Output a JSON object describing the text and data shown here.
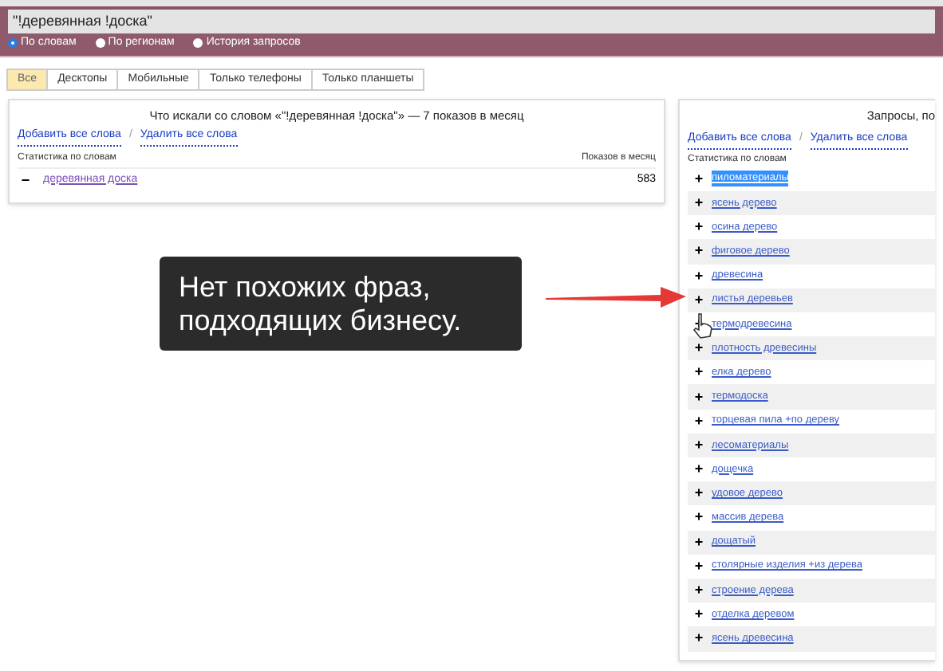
{
  "search": {
    "value": "\"!деревянная !доска\""
  },
  "modes": [
    {
      "label": "По словам",
      "selected": true
    },
    {
      "label": "По регионам",
      "selected": false
    },
    {
      "label": "История запросов",
      "selected": false
    }
  ],
  "tabs": [
    {
      "label": "Все",
      "selected": true
    },
    {
      "label": "Десктопы",
      "selected": false
    },
    {
      "label": "Мобильные",
      "selected": false
    },
    {
      "label": "Только телефоны",
      "selected": false
    },
    {
      "label": "Только планшеты",
      "selected": false
    }
  ],
  "left_panel": {
    "title": "Что искали со словом «\"!деревянная !доска\"» — 7 показов в месяц",
    "add_all": "Добавить все слова",
    "separator": "/",
    "remove_all": "Удалить все слова",
    "columns": [
      "Статистика по словам",
      "Показов в месяц"
    ],
    "rows": [
      {
        "action": "−",
        "phrase": "деревянная доска",
        "count": "583"
      }
    ]
  },
  "callout": {
    "lines": [
      "Нет похожих фраз,",
      "подходящих бизнесу."
    ]
  },
  "right_panel": {
    "title": "Запросы, по",
    "add_all": "Добавить все слова",
    "separator": "/",
    "remove_all": "Удалить все слова",
    "column": "Статистика по словам",
    "rows": [
      {
        "action": "+",
        "phrase": "пиломатериалы",
        "selected": true
      },
      {
        "action": "+",
        "phrase": "ясень дерево",
        "selected": false
      },
      {
        "action": "+",
        "phrase": "осина дерево",
        "selected": false
      },
      {
        "action": "+",
        "phrase": "фиговое дерево",
        "selected": false
      },
      {
        "action": "+",
        "phrase": "древесина",
        "selected": false
      },
      {
        "action": "+",
        "phrase": "листья деревьев",
        "selected": false
      },
      {
        "action": "+",
        "phrase": "термодревесина",
        "selected": false
      },
      {
        "action": "+",
        "phrase": "плотность древесины",
        "selected": false
      },
      {
        "action": "+",
        "phrase": "елка дерево",
        "selected": false
      },
      {
        "action": "+",
        "phrase": "термодоска",
        "selected": false
      },
      {
        "action": "+",
        "phrase": "торцевая пила +по дереву",
        "selected": false
      },
      {
        "action": "+",
        "phrase": "лесоматериалы",
        "selected": false
      },
      {
        "action": "+",
        "phrase": "дощечка",
        "selected": false
      },
      {
        "action": "+",
        "phrase": "удовое дерево",
        "selected": false
      },
      {
        "action": "+",
        "phrase": "массив дерева",
        "selected": false
      },
      {
        "action": "+",
        "phrase": "дощатый",
        "selected": false
      },
      {
        "action": "+",
        "phrase": "столярные изделия +из дерева",
        "selected": false
      },
      {
        "action": "+",
        "phrase": "строение дерева",
        "selected": false
      },
      {
        "action": "+",
        "phrase": "отделка деревом",
        "selected": false
      },
      {
        "action": "+",
        "phrase": "ясень древесина",
        "selected": false
      }
    ]
  }
}
